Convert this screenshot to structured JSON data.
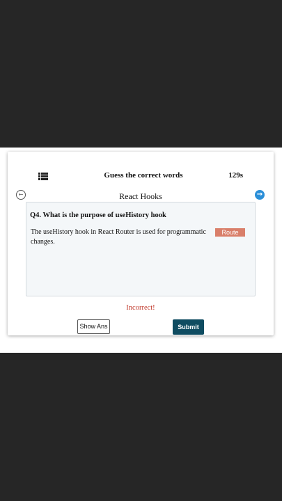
{
  "header": {
    "menu_icon": "list-menu-icon",
    "title": "Guess the correct words",
    "timer": "129s"
  },
  "nav": {
    "prev_icon": "arrow-left-circle-icon",
    "prev_glyph": "←",
    "next_icon": "arrow-right-circle-icon",
    "next_glyph": "→",
    "next_color": "#2b8fd8"
  },
  "quiz": {
    "topic": "React Hooks",
    "question": "Q4. What is the purpose of useHistory hook",
    "sentence_part1": "The useHistory hook in React Router is used for programmatic",
    "sentence_part2": "changes.",
    "blank_value": "Route",
    "blank_color": "#d97f6a"
  },
  "feedback": {
    "text": "Incorrect!",
    "color": "#c0392b"
  },
  "actions": {
    "show_answer_label": "Show Ans",
    "submit_label": "Submit",
    "submit_color": "#0f4c61"
  }
}
